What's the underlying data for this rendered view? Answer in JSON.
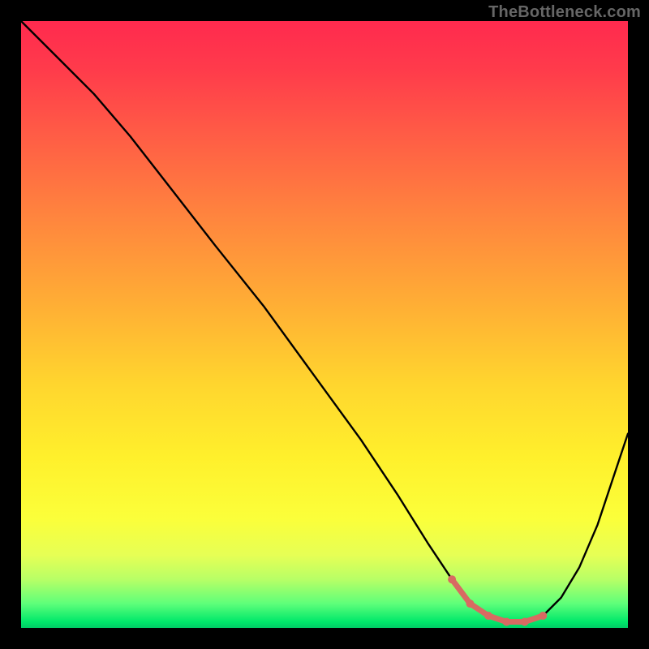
{
  "watermark": "TheBottleneck.com",
  "colors": {
    "page_bg": "#000000",
    "gradient_top": "#ff2a4e",
    "gradient_bottom": "#00cc66",
    "curve": "#000000",
    "marker": "#d86a62"
  },
  "chart_data": {
    "type": "line",
    "title": "",
    "xlabel": "",
    "ylabel": "",
    "xlim": [
      0,
      100
    ],
    "ylim": [
      0,
      100
    ],
    "grid": false,
    "legend": false,
    "series": [
      {
        "name": "bottleneck-curve",
        "x": [
          0,
          3,
          7,
          12,
          18,
          25,
          32,
          40,
          48,
          56,
          62,
          67,
          71,
          74,
          77,
          80,
          83,
          86,
          89,
          92,
          95,
          98,
          100
        ],
        "y": [
          100,
          97,
          93,
          88,
          81,
          72,
          63,
          53,
          42,
          31,
          22,
          14,
          8,
          4,
          2,
          1,
          1,
          2,
          5,
          10,
          17,
          26,
          32
        ]
      }
    ],
    "highlight": {
      "name": "optimal-range",
      "x": [
        71,
        74,
        77,
        80,
        83,
        86
      ],
      "y": [
        8,
        4,
        2,
        1,
        1,
        2
      ]
    }
  }
}
